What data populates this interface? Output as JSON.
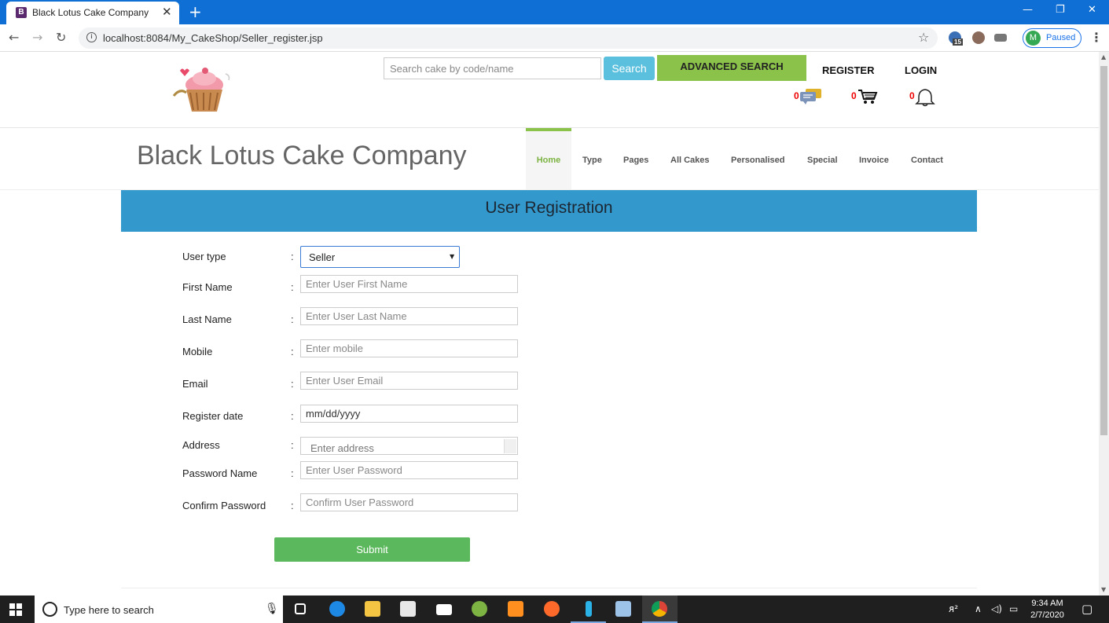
{
  "browser": {
    "tab_title": "Black Lotus Cake Company",
    "tab_favicon": "B",
    "url": "localhost:8084/My_CakeShop/Seller_register.jsp",
    "extension_badge": "15",
    "profile_initial": "M",
    "profile_status": "Paused"
  },
  "header": {
    "search_placeholder": "Search cake by code/name",
    "search_button": "Search",
    "advanced_search": "ADVANCED SEARCH",
    "register": "REGISTER",
    "login": "LOGIN",
    "messages_count": "0",
    "cart_count": "0",
    "notifications_count": "0"
  },
  "brand": "Black Lotus Cake Company",
  "nav": {
    "items": [
      "Home",
      "Type",
      "Pages",
      "All Cakes",
      "Personalised",
      "Special",
      "Invoice",
      "Contact"
    ],
    "active": "Home",
    "accent": "#8bc34a"
  },
  "form": {
    "title": "User Registration",
    "colon": ":",
    "user_type_label": "User type",
    "user_type_value": "Seller",
    "first_name_label": "First Name",
    "first_name_placeholder": "Enter User First Name",
    "last_name_label": "Last Name",
    "last_name_placeholder": "Enter User Last Name",
    "mobile_label": "Mobile",
    "mobile_placeholder": "Enter mobile",
    "email_label": "Email",
    "email_placeholder": "Enter User Email",
    "register_date_label": "Register date",
    "register_date_value": "mm/dd/yyyy",
    "address_label": "Address",
    "address_placeholder": "Enter address",
    "password_label": "Password Name",
    "password_placeholder": "Enter User Password",
    "confirm_label": "Confirm Password",
    "confirm_placeholder": "Confirm User Password",
    "submit": "Submit"
  },
  "taskbar": {
    "search_text": "Type here to search",
    "time": "9:34 AM",
    "date": "2/7/2020"
  },
  "colors": {
    "banner": "#3399cc",
    "search_button": "#5bc0de",
    "advanced_button": "#8bc34a",
    "submit_button": "#5cb85c",
    "counter": "#ee0000"
  }
}
